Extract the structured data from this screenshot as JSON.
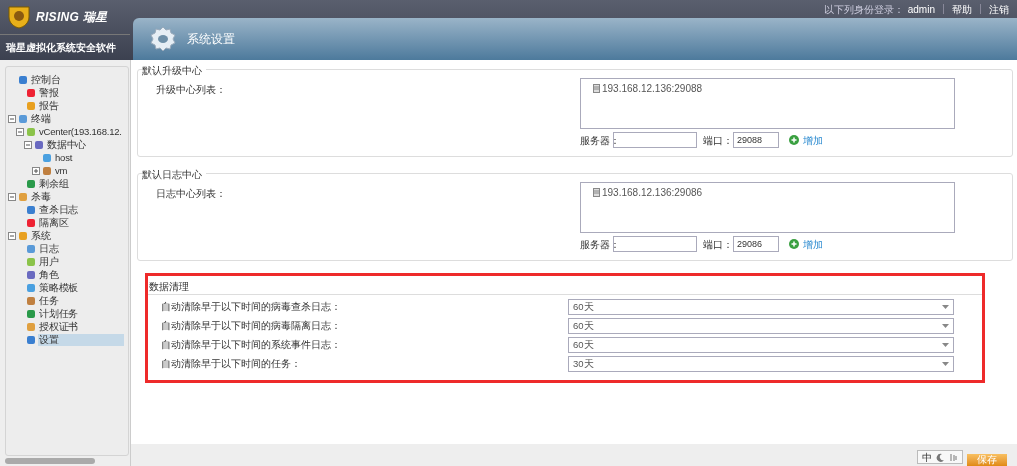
{
  "header": {
    "brand": "RISING 瑞星",
    "subtitle": "瑞星虚拟化系统安全软件",
    "login_label": "以下列身份登录：",
    "user": "admin",
    "links": [
      "帮助",
      "注销"
    ],
    "page_title": "系统设置"
  },
  "tree": [
    {
      "label": "控制台",
      "selected": false,
      "children": [
        {
          "label": "警报",
          "selected": false
        },
        {
          "label": "报告",
          "selected": false
        }
      ]
    },
    {
      "label": "终端",
      "selected": false,
      "expanded": true,
      "children": [
        {
          "label": "vCenter(193.168.12.",
          "selected": false,
          "expanded": true,
          "children": [
            {
              "label": "数据中心",
              "selected": false,
              "expanded": true,
              "children": [
                {
                  "label": "host",
                  "selected": false
                },
                {
                  "label": "vm",
                  "selected": false,
                  "expanded": false
                }
              ]
            }
          ]
        },
        {
          "label": "剩余组",
          "selected": false
        }
      ]
    },
    {
      "label": "杀毒",
      "selected": false,
      "expanded": true,
      "children": [
        {
          "label": "查杀日志",
          "selected": false
        },
        {
          "label": "隔离区",
          "selected": false
        }
      ]
    },
    {
      "label": "系统",
      "selected": false,
      "expanded": true,
      "children": [
        {
          "label": "日志",
          "selected": false
        },
        {
          "label": "用户",
          "selected": false
        },
        {
          "label": "角色",
          "selected": false
        },
        {
          "label": "策略模板",
          "selected": false
        },
        {
          "label": "任务",
          "selected": false
        },
        {
          "label": "计划任务",
          "selected": false
        },
        {
          "label": "授权证书",
          "selected": false
        },
        {
          "label": "设置",
          "selected": true
        }
      ]
    }
  ],
  "centers": [
    {
      "legend": "默认升级中心",
      "list_label": "升级中心列表：",
      "entries": [
        "193.168.12.136:29088"
      ],
      "server_label": "服务器：",
      "port_label": "端口：",
      "port_value": "29088",
      "add_label": "增加"
    },
    {
      "legend": "默认日志中心",
      "list_label": "日志中心列表：",
      "entries": [
        "193.168.12.136:29086"
      ],
      "server_label": "服务器：",
      "port_label": "端口：",
      "port_value": "29086",
      "add_label": "增加"
    }
  ],
  "cleanup": {
    "legend": "数据清理",
    "highlighted": true,
    "rows": [
      {
        "label": "自动清除早于以下时间的病毒查杀日志：",
        "value": "60天"
      },
      {
        "label": "自动清除早于以下时间的病毒隔离日志：",
        "value": "60天"
      },
      {
        "label": "自动清除早于以下时间的系统事件日志：",
        "value": "60天"
      },
      {
        "label": "自动清除早于以下时间的任务：",
        "value": "30天"
      }
    ]
  },
  "ime": {
    "mode": "中"
  },
  "save_button": "保存"
}
